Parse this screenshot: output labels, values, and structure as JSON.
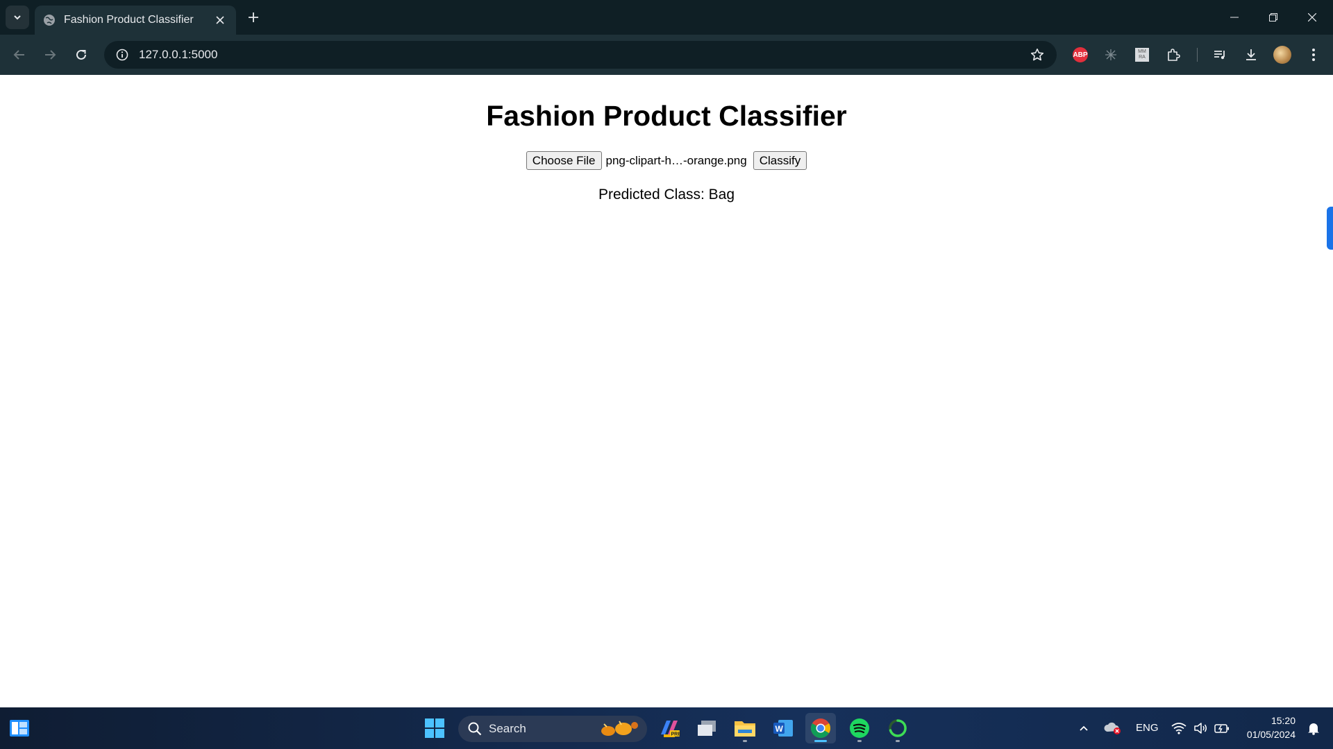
{
  "browser": {
    "tab_title": "Fashion Product Classifier",
    "url": "127.0.0.1:5000",
    "extensions": [
      "abp-icon",
      "sparkle-icon",
      "mmra-icon",
      "puzzle-icon"
    ],
    "abp_label": "ABP",
    "mmra_label_top": "MM",
    "mmra_label_bottom": "RA"
  },
  "page": {
    "title": "Fashion Product Classifier",
    "choose_file_label": "Choose File",
    "file_name": "png-clipart-h…-orange.png",
    "classify_label": "Classify",
    "prediction_text": "Predicted Class: Bag"
  },
  "taskbar": {
    "search_label": "Search",
    "language": "ENG",
    "time": "15:20",
    "date": "01/05/2024"
  },
  "colors": {
    "titlebar": "#0f1f25",
    "toolbar": "#1e3138",
    "accent": "#1a73e8"
  }
}
